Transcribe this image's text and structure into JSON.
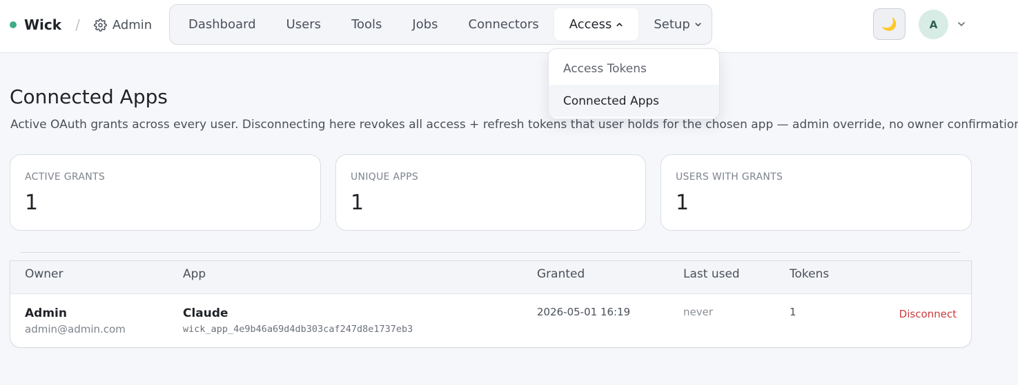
{
  "brand": {
    "name": "Wick",
    "separator": "/",
    "section": "Admin",
    "dot_color": "#3fae86"
  },
  "nav": {
    "items": [
      {
        "label": "Dashboard"
      },
      {
        "label": "Users"
      },
      {
        "label": "Tools"
      },
      {
        "label": "Jobs"
      },
      {
        "label": "Connectors"
      },
      {
        "label": "Access"
      },
      {
        "label": "Setup"
      }
    ],
    "active": "Access"
  },
  "header": {
    "theme_icon": "moon-icon",
    "avatar_initial": "A"
  },
  "dropdown": {
    "items": [
      {
        "label": "Access Tokens"
      },
      {
        "label": "Connected Apps"
      }
    ],
    "selected": "Connected Apps"
  },
  "page": {
    "title": "Connected Apps",
    "description": "Active OAuth grants across every user. Disconnecting here revokes all access + refresh tokens that user holds for the chosen app — admin override, no owner confirmation."
  },
  "stats": [
    {
      "label": "ACTIVE GRANTS",
      "value": "1"
    },
    {
      "label": "UNIQUE APPS",
      "value": "1"
    },
    {
      "label": "USERS WITH GRANTS",
      "value": "1"
    }
  ],
  "table": {
    "columns": [
      "Owner",
      "App",
      "Granted",
      "Last used",
      "Tokens"
    ],
    "rows": [
      {
        "owner_name": "Admin",
        "owner_email": "admin@admin.com",
        "app_name": "Claude",
        "app_id": "wick_app_4e9b46a69d4db303caf247d8e1737eb3",
        "granted": "2026-05-01 16:19",
        "last_used": "never",
        "tokens": "1",
        "action": "Disconnect"
      }
    ]
  },
  "colors": {
    "accent_green": "#3fae86",
    "danger": "#cc3b3b"
  }
}
